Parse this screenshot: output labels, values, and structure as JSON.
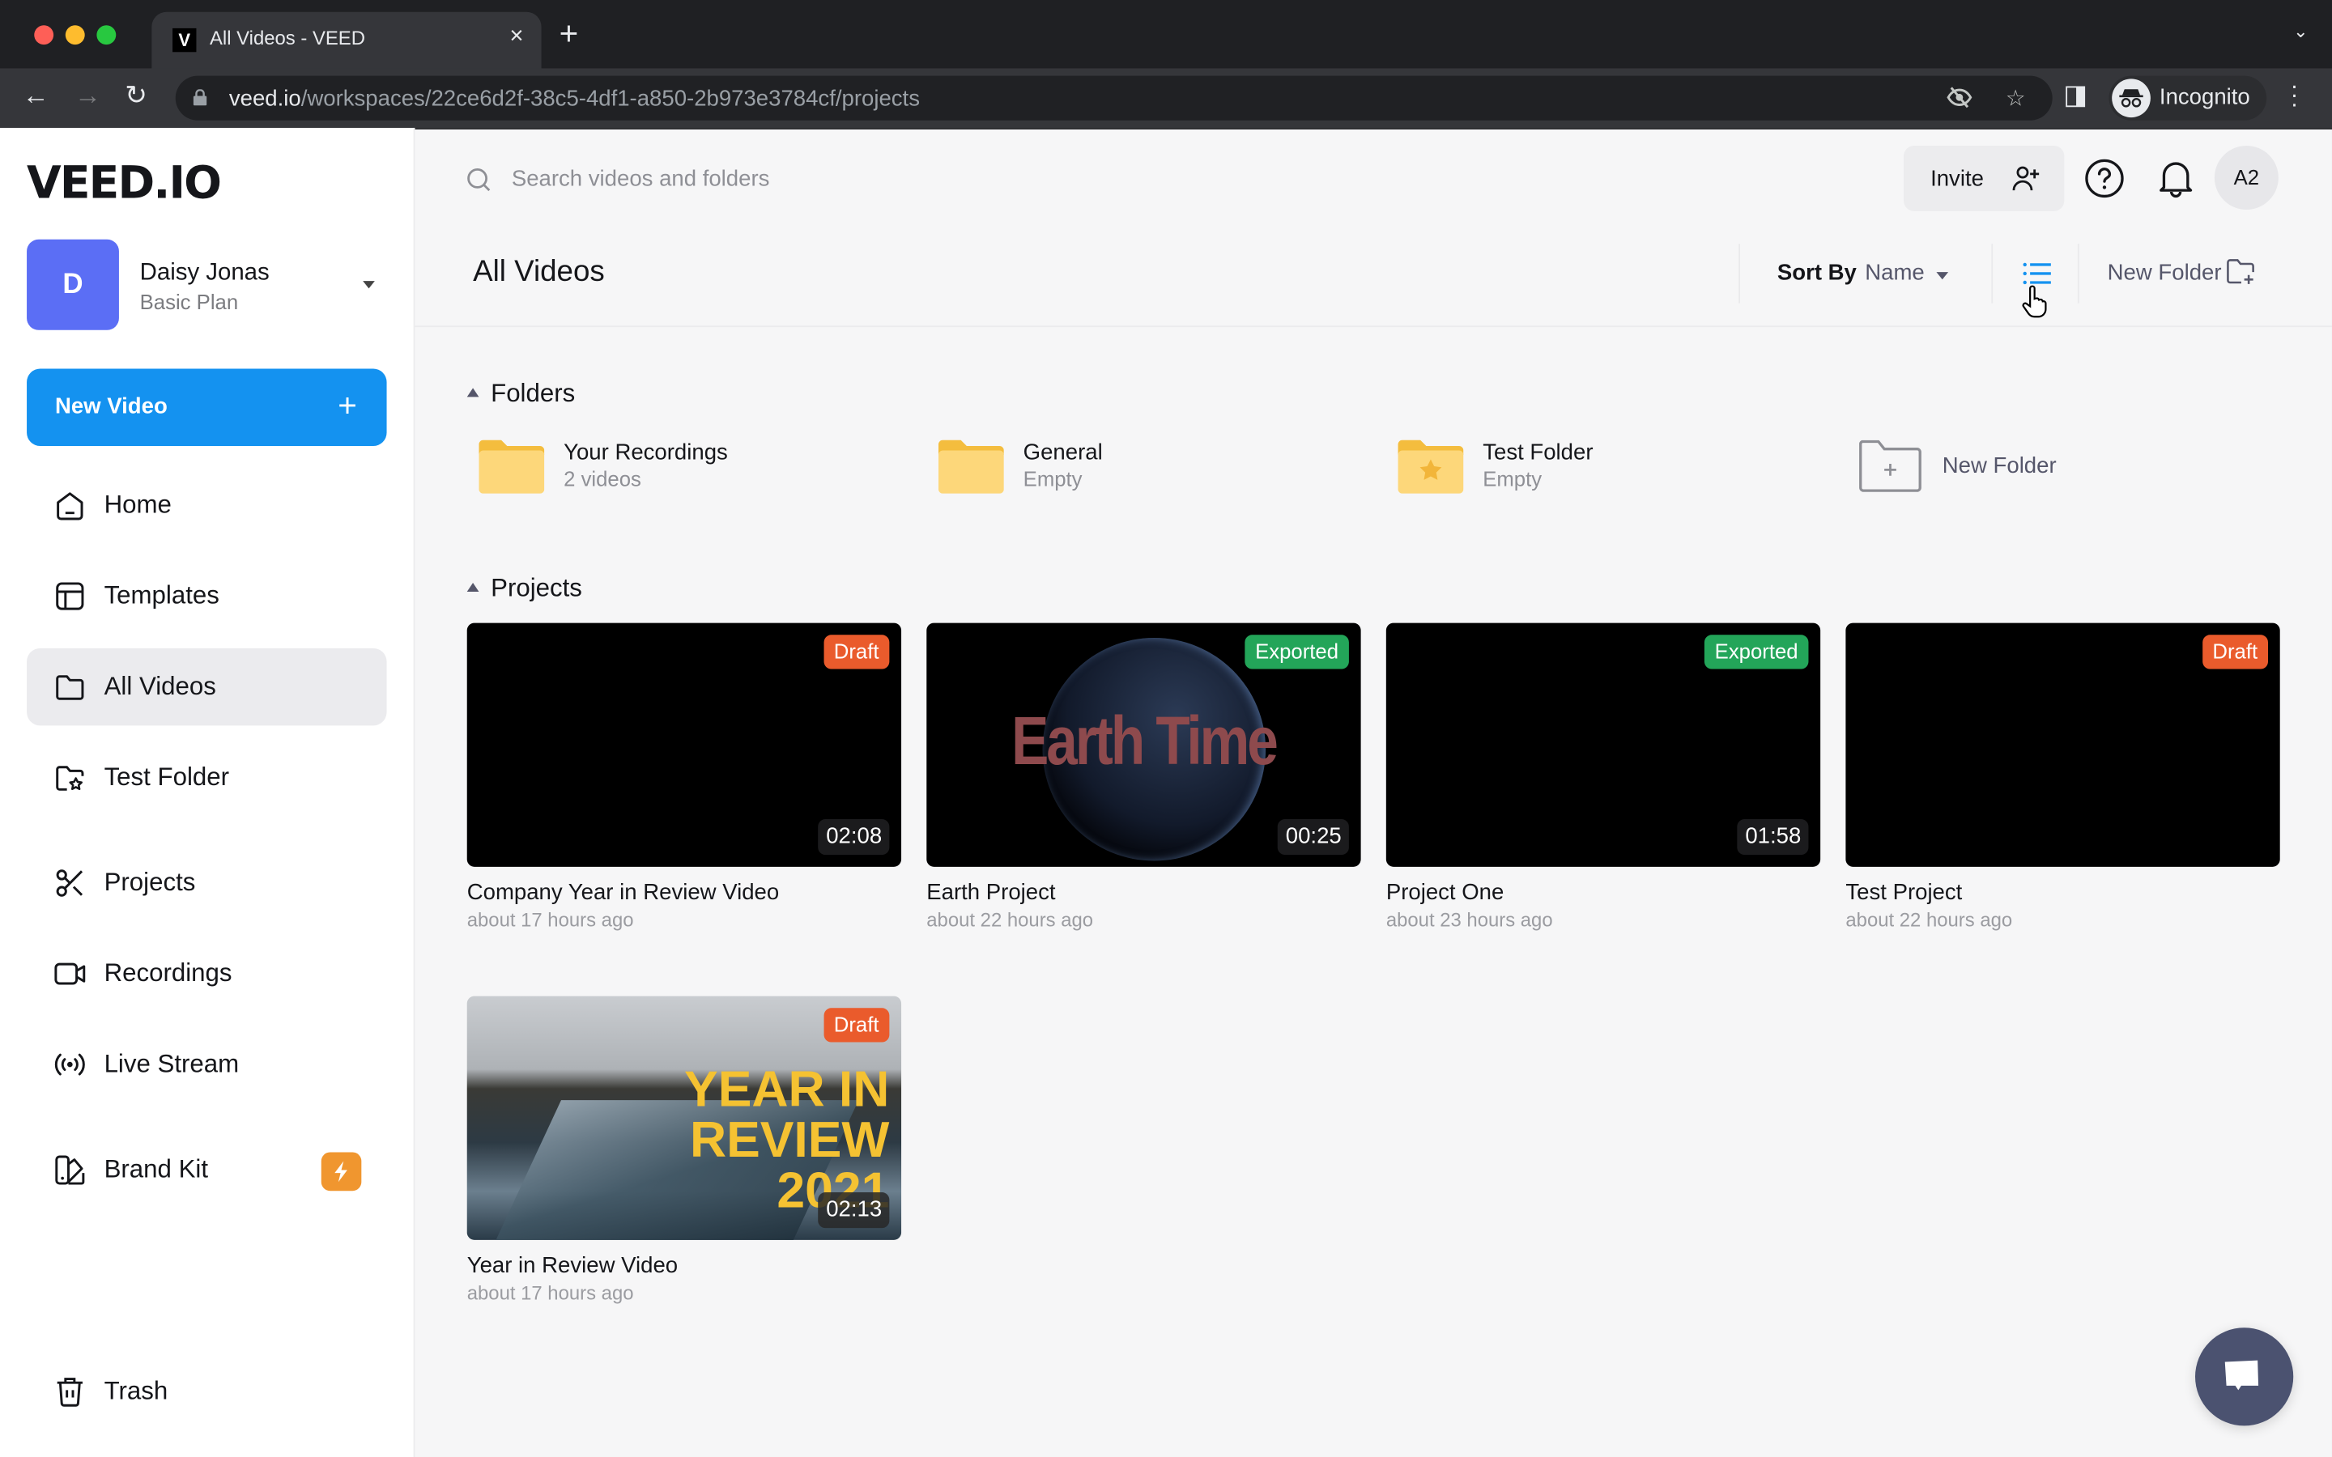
{
  "browser": {
    "tab_title": "All Videos - VEED",
    "tab_favicon": "V",
    "new_tab_icon": "+",
    "url_host": "veed.io",
    "url_path": "/workspaces/22ce6d2f-38c5-4df1-a850-2b973e3784cf/projects",
    "profile_label": "Incognito"
  },
  "sidebar": {
    "logo": "VEED.IO",
    "account": {
      "initial": "D",
      "name": "Daisy Jonas",
      "plan": "Basic Plan"
    },
    "new_video_label": "New Video",
    "items": [
      {
        "label": "Home",
        "icon": "home-icon"
      },
      {
        "label": "Templates",
        "icon": "templates-icon"
      },
      {
        "label": "All Videos",
        "icon": "folder-icon",
        "active": true
      },
      {
        "label": "Test Folder",
        "icon": "folder-star-icon"
      },
      {
        "label": "Projects",
        "icon": "scissors-icon"
      },
      {
        "label": "Recordings",
        "icon": "video-camera-icon"
      },
      {
        "label": "Live Stream",
        "icon": "broadcast-icon"
      },
      {
        "label": "Brand Kit",
        "icon": "brand-kit-icon",
        "badge": "bolt-icon"
      },
      {
        "label": "Trash",
        "icon": "trash-icon"
      }
    ]
  },
  "header": {
    "search_placeholder": "Search videos and folders",
    "invite_label": "Invite",
    "user_initials": "A2"
  },
  "toolbar": {
    "page_title": "All Videos",
    "sort_by_label": "Sort By",
    "sort_value": "Name",
    "new_folder_label": "New Folder"
  },
  "folders": {
    "section_label": "Folders",
    "items": [
      {
        "name": "Your Recordings",
        "sub": "2 videos"
      },
      {
        "name": "General",
        "sub": "Empty"
      },
      {
        "name": "Test Folder",
        "sub": "Empty",
        "starred": true
      }
    ],
    "new_folder_label": "New Folder"
  },
  "projects": {
    "section_label": "Projects",
    "items": [
      {
        "title": "Company Year in Review Video",
        "time": "about 17 hours ago",
        "status": "Draft",
        "duration": "02:08"
      },
      {
        "title": "Earth Project",
        "time": "about 22 hours ago",
        "status": "Exported",
        "duration": "00:25",
        "thumb_text": "Earth Time"
      },
      {
        "title": "Project One",
        "time": "about 23 hours ago",
        "status": "Exported",
        "duration": "01:58"
      },
      {
        "title": "Test Project",
        "time": "about 22 hours ago",
        "status": "Draft",
        "duration": ""
      },
      {
        "title": "Year in Review Video",
        "time": "about 17 hours ago",
        "status": "Draft",
        "duration": "02:13",
        "thumb_text": "YEAR IN REVIEW 2021"
      }
    ]
  },
  "colors": {
    "accent": "#1492f0",
    "draft": "#ea5b2c",
    "exported": "#23a559",
    "avatar": "#5b6ef5",
    "bolt": "#f0962f",
    "chat": "#4b5270"
  }
}
